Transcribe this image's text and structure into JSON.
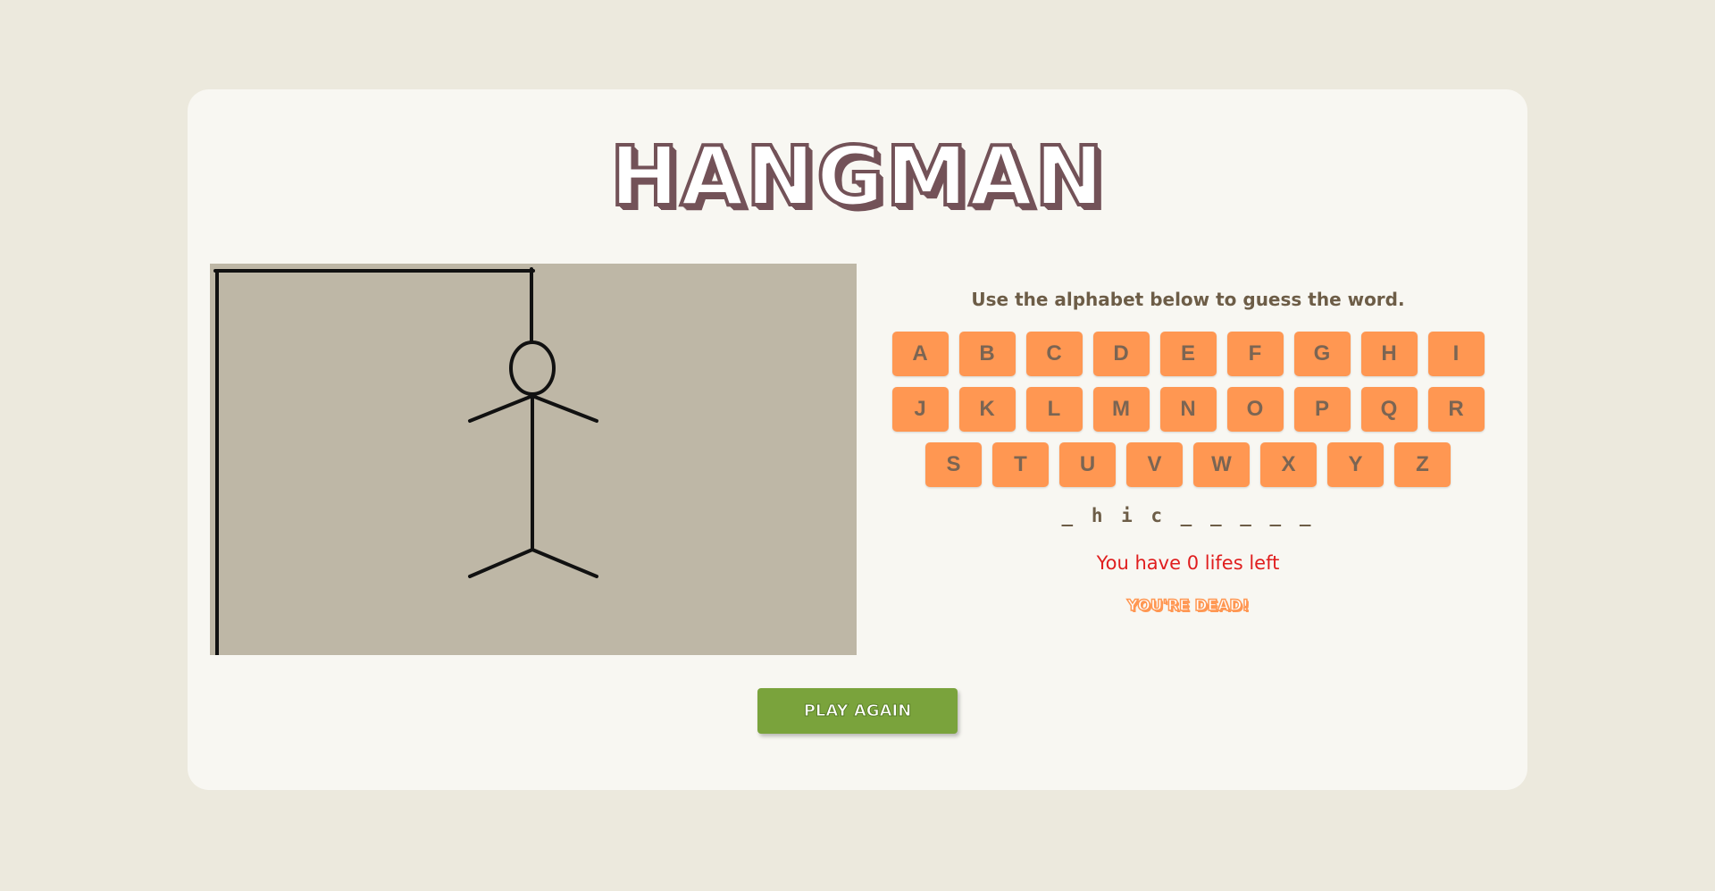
{
  "game": {
    "title": "HANGMAN",
    "instructions": "Use the alphabet below to guess the word.",
    "alphabet_rows": [
      [
        "A",
        "B",
        "C",
        "D",
        "E",
        "F",
        "G",
        "H",
        "I"
      ],
      [
        "J",
        "K",
        "L",
        "M",
        "N",
        "O",
        "P",
        "Q",
        "R"
      ],
      [
        "S",
        "T",
        "U",
        "V",
        "W",
        "X",
        "Y",
        "Z"
      ]
    ],
    "word_display": "_ h i c _ _ _ _ _",
    "lives_text": "You have 0 lifes left",
    "status_text": "YOU'RE DEAD!",
    "play_again_label": "PLAY AGAIN"
  },
  "colors": {
    "background": "#ece9dd",
    "card": "#f8f7f2",
    "title": "#735258",
    "key": "#ff9752",
    "key_text": "#7b6553",
    "lives_text": "#e01e1e",
    "status_text": "#ff9752",
    "play_again": "#7aa33c",
    "gallows_bg": "#beb7a6"
  },
  "icons": {
    "gallows": "hangman-gallows-icon"
  }
}
